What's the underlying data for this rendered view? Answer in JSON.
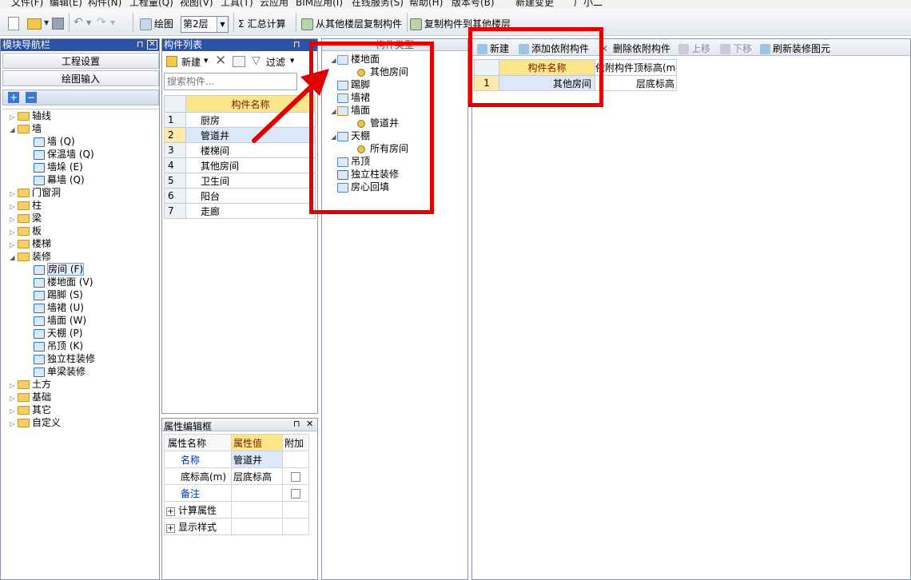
{
  "menu": [
    "文件(F)",
    "编辑(E)",
    "构件(N)",
    "工程量(Q)",
    "视图(V)",
    "工具(T)",
    "云应用",
    "BIM应用(I)",
    "在线服务(S)",
    "帮助(H)",
    "版本号(B)",
    "新建变更",
    "广小二"
  ],
  "toolbar": {
    "draw_label": "绘图",
    "floor_value": "第2层",
    "sum_label": "汇总计算",
    "copy_from_label": "从其他楼层复制构件",
    "copy_to_label": "复制构件到其他楼层"
  },
  "nav": {
    "title": "模块导航栏",
    "btn_settings": "工程设置",
    "btn_draw": "绘图输入",
    "plus": "+",
    "minus": "−",
    "tree": [
      {
        "label": "轴线",
        "level": 0,
        "toggle": "▷",
        "kind": "folder"
      },
      {
        "label": "墙",
        "level": 0,
        "toggle": "◢",
        "kind": "folder"
      },
      {
        "label": "墙 (Q)",
        "level": 1,
        "toggle": "",
        "kind": "item"
      },
      {
        "label": "保温墙 (Q)",
        "level": 1,
        "toggle": "",
        "kind": "item"
      },
      {
        "label": "墙垛 (E)",
        "level": 1,
        "toggle": "",
        "kind": "item"
      },
      {
        "label": "幕墙 (Q)",
        "level": 1,
        "toggle": "",
        "kind": "item"
      },
      {
        "label": "门窗洞",
        "level": 0,
        "toggle": "▷",
        "kind": "folder"
      },
      {
        "label": "柱",
        "level": 0,
        "toggle": "▷",
        "kind": "folder"
      },
      {
        "label": "梁",
        "level": 0,
        "toggle": "▷",
        "kind": "folder"
      },
      {
        "label": "板",
        "level": 0,
        "toggle": "▷",
        "kind": "folder"
      },
      {
        "label": "楼梯",
        "level": 0,
        "toggle": "▷",
        "kind": "folder"
      },
      {
        "label": "装修",
        "level": 0,
        "toggle": "◢",
        "kind": "folder"
      },
      {
        "label": "房间 (F)",
        "level": 1,
        "toggle": "",
        "kind": "item",
        "selected": true
      },
      {
        "label": "楼地面 (V)",
        "level": 1,
        "toggle": "",
        "kind": "item"
      },
      {
        "label": "踢脚 (S)",
        "level": 1,
        "toggle": "",
        "kind": "item"
      },
      {
        "label": "墙裙 (U)",
        "level": 1,
        "toggle": "",
        "kind": "item"
      },
      {
        "label": "墙面 (W)",
        "level": 1,
        "toggle": "",
        "kind": "item"
      },
      {
        "label": "天棚 (P)",
        "level": 1,
        "toggle": "",
        "kind": "item"
      },
      {
        "label": "吊顶 (K)",
        "level": 1,
        "toggle": "",
        "kind": "item"
      },
      {
        "label": "独立柱装修",
        "level": 1,
        "toggle": "",
        "kind": "item"
      },
      {
        "label": "单梁装修",
        "level": 1,
        "toggle": "",
        "kind": "item"
      },
      {
        "label": "土方",
        "level": 0,
        "toggle": "▷",
        "kind": "folder"
      },
      {
        "label": "基础",
        "level": 0,
        "toggle": "▷",
        "kind": "folder"
      },
      {
        "label": "其它",
        "level": 0,
        "toggle": "▷",
        "kind": "folder"
      },
      {
        "label": "自定义",
        "level": 0,
        "toggle": "▷",
        "kind": "folder"
      }
    ]
  },
  "component_list": {
    "title": "构件列表",
    "new_label": "新建",
    "filter_label": "过滤",
    "search_placeholder": "搜索构件...",
    "header": "构件名称",
    "rows": [
      {
        "no": "1",
        "name": "厨房"
      },
      {
        "no": "2",
        "name": "管道井",
        "selected": true
      },
      {
        "no": "3",
        "name": "楼梯间"
      },
      {
        "no": "4",
        "name": "其他房间"
      },
      {
        "no": "5",
        "name": "卫生间"
      },
      {
        "no": "6",
        "name": "阳台"
      },
      {
        "no": "7",
        "name": "走廊"
      }
    ]
  },
  "properties": {
    "title": "属性编辑框",
    "headers": [
      "属性名称",
      "属性值",
      "附加"
    ],
    "rows": [
      {
        "name": "名称",
        "value": "管道井",
        "check": false,
        "highlight": true
      },
      {
        "name": "底标高(m)",
        "value": "层底标高",
        "check": true
      },
      {
        "name": "备注",
        "value": "",
        "check": true,
        "highlight": true
      },
      {
        "name": "计算属性",
        "value": "",
        "check": false,
        "expand": "+"
      },
      {
        "name": "显示样式",
        "value": "",
        "check": false,
        "expand": "+"
      }
    ]
  },
  "type_panel": {
    "title": "构件类型",
    "tree": [
      {
        "label": "楼地面",
        "level": 0,
        "toggle": "◢"
      },
      {
        "label": "其他房间",
        "level": 1,
        "toggle": ""
      },
      {
        "label": "踢脚",
        "level": 0,
        "toggle": ""
      },
      {
        "label": "墙裙",
        "level": 0,
        "toggle": ""
      },
      {
        "label": "墙面",
        "level": 0,
        "toggle": "◢"
      },
      {
        "label": "管道井",
        "level": 1,
        "toggle": ""
      },
      {
        "label": "天棚",
        "level": 0,
        "toggle": "◢"
      },
      {
        "label": "所有房间",
        "level": 1,
        "toggle": ""
      },
      {
        "label": "吊顶",
        "level": 0,
        "toggle": ""
      },
      {
        "label": "独立柱装修",
        "level": 0,
        "toggle": ""
      },
      {
        "label": "房心回填",
        "level": 0,
        "toggle": ""
      }
    ]
  },
  "attached": {
    "toolbar": [
      "新建",
      "添加依附构件",
      "删除依附构件",
      "上移",
      "下移",
      "刷新装修图元"
    ],
    "headers": [
      "构件名称",
      "依附构件顶标高(m"
    ],
    "rows": [
      {
        "no": "1",
        "name": "其他房间",
        "height": "层底标高"
      }
    ]
  },
  "colors": {
    "highlight_red": "#e50000",
    "title_blue": "#2a52a8",
    "header_yellow": "#fce68a"
  }
}
